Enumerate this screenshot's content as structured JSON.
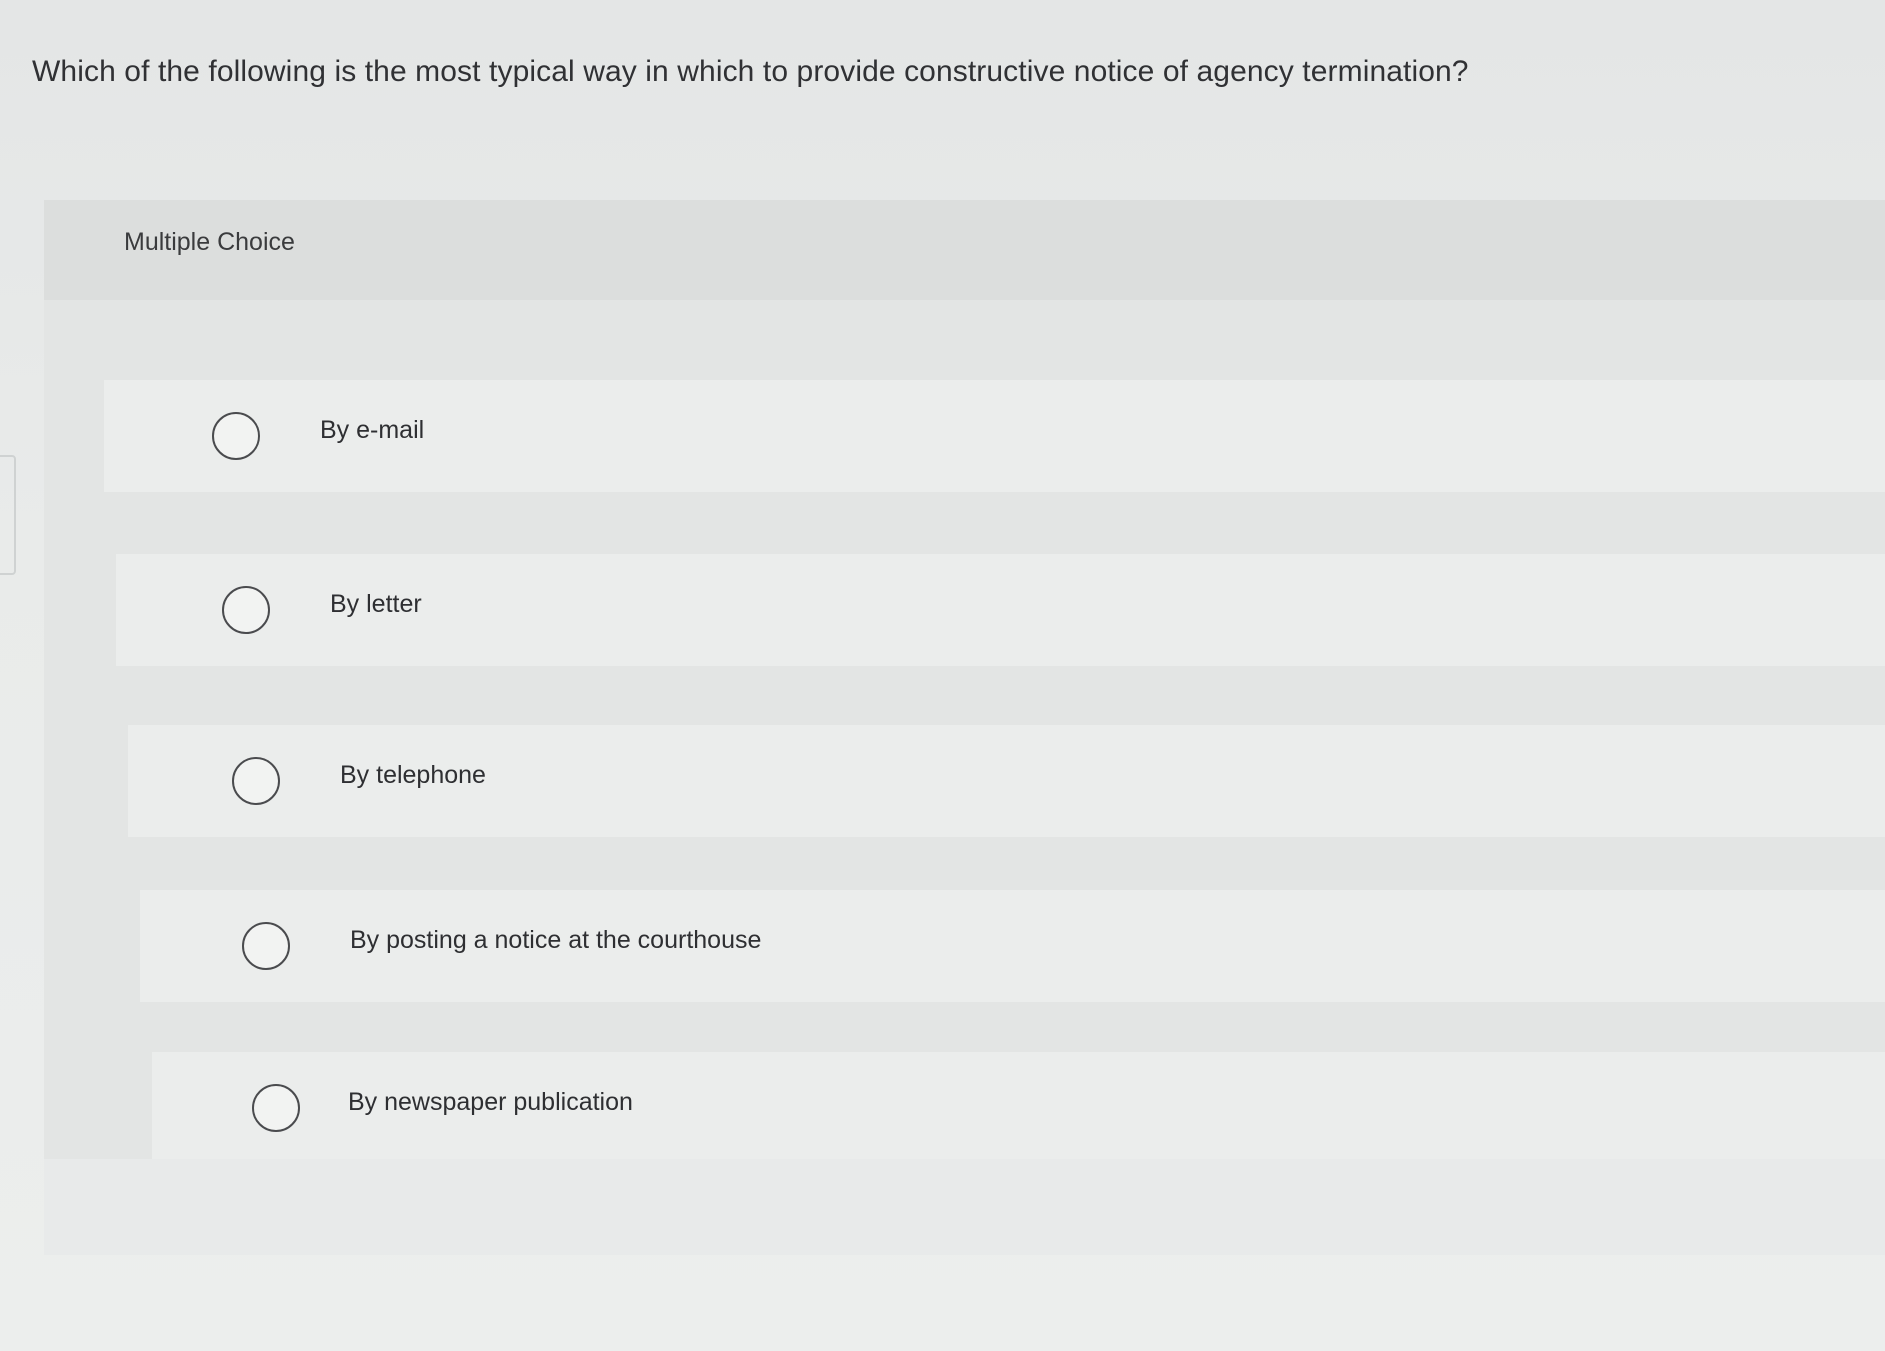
{
  "question": {
    "text": "Which of the following is the most typical way in which to provide constructive notice of agency termination?"
  },
  "panel": {
    "label": "Multiple Choice"
  },
  "options": [
    {
      "label": "By e-mail",
      "selected": false
    },
    {
      "label": "By letter",
      "selected": false
    },
    {
      "label": "By telephone",
      "selected": false
    },
    {
      "label": "By posting a notice at the courthouse",
      "selected": false
    },
    {
      "label": "By newspaper publication",
      "selected": false
    }
  ],
  "colors": {
    "text": "#2f2f31",
    "panel_background": "#e2e4e4",
    "option_background": "#ebedec",
    "radio_border": "#4a4b4e"
  }
}
